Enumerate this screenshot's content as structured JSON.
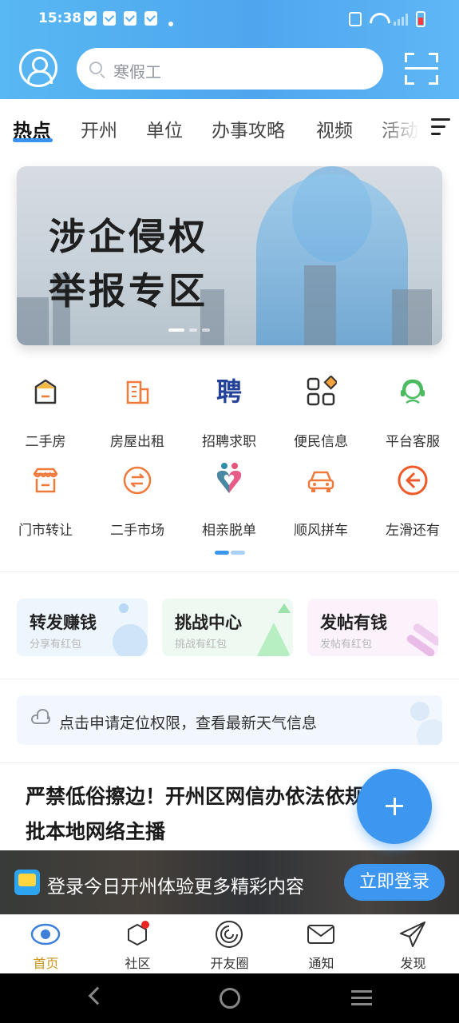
{
  "status_bar": {
    "time": "15:38"
  },
  "header": {
    "search_placeholder": "寒假工"
  },
  "tabs": {
    "items": [
      "热点",
      "开州",
      "单位",
      "办事攻略",
      "视频",
      "活动"
    ],
    "active": "热点"
  },
  "banner": {
    "line1": "涉企侵权",
    "line2": "举报专区"
  },
  "services": {
    "items": [
      {
        "label": "二手房",
        "icon": "house-icon"
      },
      {
        "label": "房屋出租",
        "icon": "building-icon"
      },
      {
        "label": "招聘求职",
        "icon": "recruit-icon",
        "glyph": "聘"
      },
      {
        "label": "便民信息",
        "icon": "grid-apps-icon"
      },
      {
        "label": "平台客服",
        "icon": "headset-icon"
      },
      {
        "label": "门市转让",
        "icon": "shop-icon"
      },
      {
        "label": "二手市场",
        "icon": "exchange-icon"
      },
      {
        "label": "相亲脱单",
        "icon": "dating-icon"
      },
      {
        "label": "顺风拼车",
        "icon": "car-icon"
      },
      {
        "label": "左滑还有",
        "icon": "arrow-left-icon"
      }
    ]
  },
  "cards": [
    {
      "title": "转发赚钱",
      "subtitle": "分享有红包",
      "color": "#edf5fd"
    },
    {
      "title": "挑战中心",
      "subtitle": "挑战有红包",
      "color": "#eefaf1"
    },
    {
      "title": "发帖有钱",
      "subtitle": "发帖有红包",
      "color": "#fbf2fb"
    }
  ],
  "weather": {
    "text": "点击申请定位权限，查看最新天气信息"
  },
  "news": {
    "title": "严禁低俗擦边！开州区网信办依法依规处置一批本地网络主播"
  },
  "fab": {
    "icon": "plus-icon"
  },
  "login_bar": {
    "text": "登录今日开州体验更多精彩内容",
    "button": "立即登录"
  },
  "bottom_nav": {
    "items": [
      "首页",
      "社区",
      "开友圈",
      "通知",
      "发现"
    ],
    "active": "首页"
  },
  "colors": {
    "accent": "#3d96ef",
    "active_nav": "#c9961e",
    "icon_orange": "#f07a3c"
  }
}
